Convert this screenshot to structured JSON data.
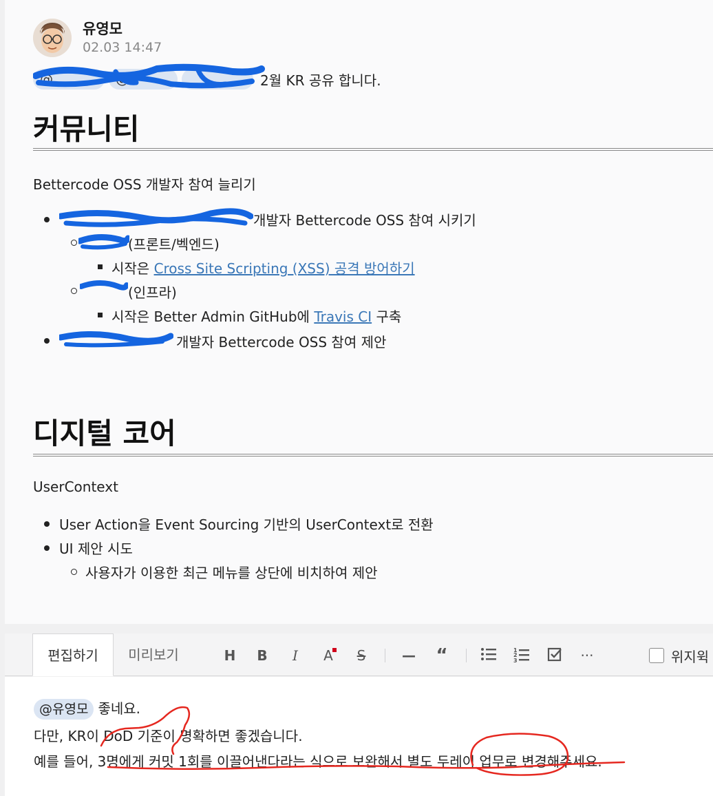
{
  "post": {
    "author": "유영모",
    "timestamp": "02.03 14:47",
    "mentions": [
      "@",
      "@",
      ""
    ],
    "mention_suffix": "2월 KR 공유 합니다."
  },
  "sections": {
    "community": {
      "title": "커뮤니티",
      "intro": "Bettercode OSS 개발자 참여 늘리기",
      "b1_text": "개발자 Bettercode OSS 참여 시키기",
      "b1_sub1": "(프론트/벡엔드)",
      "b1_sub1_item_prefix": "시작은 ",
      "b1_sub1_item_link": "Cross Site Scripting (XSS) 공격 방어하기",
      "b1_sub2": "(인프라)",
      "b1_sub2_item_prefix": "시작은 Better Admin GitHub에 ",
      "b1_sub2_item_link": "Travis CI",
      "b1_sub2_item_suffix": " 구축",
      "b2_text": "개발자 Bettercode OSS 참여 제안"
    },
    "digital_core": {
      "title": "디지털 코어",
      "intro": "UserContext",
      "b1": "User Action을 Event Sourcing 기반의 UserContext로 전환",
      "b2": "UI 제안 시도",
      "b2_sub": "사용자가 이용한 최근 메뉴를 상단에 비치하여 제안"
    }
  },
  "editor": {
    "tab_edit": "편집하기",
    "tab_preview": "미리보기",
    "toolbar": [
      "H",
      "B",
      "I",
      "A",
      "S",
      "—",
      "“",
      "list",
      "numbered-list",
      "checklist",
      "···"
    ],
    "position_label": "위지윅",
    "mention": "@유영모",
    "line1": "좋네요.",
    "line2": "다만, KR이 DoD 기준이 명확하면 좋겠습니다.",
    "line3": "예를 들어, 3명에게 커밋 1회를 이끌어낸다라는 식으로 보완해서 별도 두레이 업무로 변경해주세요."
  },
  "colors": {
    "link": "#3a77b7",
    "chip": "#dbe5f3",
    "redact": "#1565e0",
    "annotation": "#e5271f"
  }
}
